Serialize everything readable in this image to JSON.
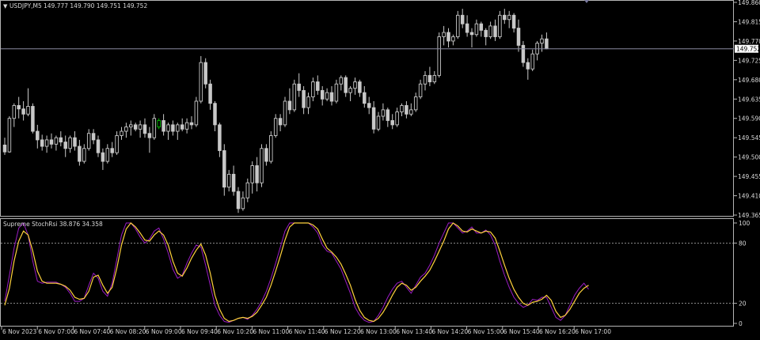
{
  "header": {
    "symbol": "USDJPY,M5",
    "ohlc": "149.777 149.790 149.751 149.752"
  },
  "indicator": {
    "label": "Supreme StochRsi 38.876 34.358"
  },
  "colors": {
    "background": "#000000",
    "candle": "#c8c8c8",
    "bull_highlight": "#00c000",
    "main_line": "#ffd23c",
    "signal_line": "#9a1cc4",
    "level_line": "#b4b4b4",
    "bid_line": "#8a8aa0",
    "frame": "#b4b4b4"
  },
  "chart_data": [
    {
      "type": "candlestick",
      "title": "USDJPY,M5",
      "ylim": [
        149.365,
        149.86
      ],
      "y_ticks": [
        "149.860",
        "149.815",
        "149.770",
        "149.725",
        "149.680",
        "149.635",
        "149.590",
        "149.545",
        "149.500",
        "149.455",
        "149.410",
        "149.365"
      ],
      "current_price": "149.752",
      "candles": [
        {
          "o": 149.528,
          "h": 149.545,
          "l": 149.505,
          "c": 149.512
        },
        {
          "o": 149.512,
          "h": 149.595,
          "l": 149.51,
          "c": 149.59
        },
        {
          "o": 149.59,
          "h": 149.625,
          "l": 149.57,
          "c": 149.62
        },
        {
          "o": 149.62,
          "h": 149.64,
          "l": 149.59,
          "c": 149.612
        },
        {
          "o": 149.612,
          "h": 149.63,
          "l": 149.585,
          "c": 149.6
        },
        {
          "o": 149.6,
          "h": 149.66,
          "l": 149.595,
          "c": 149.618
        },
        {
          "o": 149.618,
          "h": 149.625,
          "l": 149.555,
          "c": 149.56
        },
        {
          "o": 149.56,
          "h": 149.575,
          "l": 149.52,
          "c": 149.54
        },
        {
          "o": 149.54,
          "h": 149.552,
          "l": 149.515,
          "c": 149.525
        },
        {
          "o": 149.525,
          "h": 149.55,
          "l": 149.51,
          "c": 149.54
        },
        {
          "o": 149.54,
          "h": 149.555,
          "l": 149.52,
          "c": 149.53
        },
        {
          "o": 149.53,
          "h": 149.55,
          "l": 149.515,
          "c": 149.545
        },
        {
          "o": 149.545,
          "h": 149.56,
          "l": 149.525,
          "c": 149.535
        },
        {
          "o": 149.535,
          "h": 149.55,
          "l": 149.5,
          "c": 149.52
        },
        {
          "o": 149.52,
          "h": 149.55,
          "l": 149.51,
          "c": 149.545
        },
        {
          "o": 149.545,
          "h": 149.56,
          "l": 149.515,
          "c": 149.525
        },
        {
          "o": 149.525,
          "h": 149.54,
          "l": 149.48,
          "c": 149.49
        },
        {
          "o": 149.49,
          "h": 149.53,
          "l": 149.485,
          "c": 149.52
        },
        {
          "o": 149.52,
          "h": 149.565,
          "l": 149.515,
          "c": 149.555
        },
        {
          "o": 149.555,
          "h": 149.565,
          "l": 149.53,
          "c": 149.54
        },
        {
          "o": 149.54,
          "h": 149.55,
          "l": 149.5,
          "c": 149.51
        },
        {
          "o": 149.51,
          "h": 149.52,
          "l": 149.47,
          "c": 149.49
        },
        {
          "o": 149.49,
          "h": 149.53,
          "l": 149.485,
          "c": 149.52
        },
        {
          "o": 149.52,
          "h": 149.535,
          "l": 149.5,
          "c": 149.51
        },
        {
          "o": 149.51,
          "h": 149.56,
          "l": 149.505,
          "c": 149.55
        },
        {
          "o": 149.55,
          "h": 149.57,
          "l": 149.54,
          "c": 149.56
        },
        {
          "o": 149.56,
          "h": 149.58,
          "l": 149.545,
          "c": 149.57
        },
        {
          "o": 149.57,
          "h": 149.585,
          "l": 149.55,
          "c": 149.575
        },
        {
          "o": 149.575,
          "h": 149.58,
          "l": 149.56,
          "c": 149.565
        },
        {
          "o": 149.565,
          "h": 149.585,
          "l": 149.545,
          "c": 149.575
        },
        {
          "o": 149.575,
          "h": 149.59,
          "l": 149.545,
          "c": 149.555
        },
        {
          "o": 149.555,
          "h": 149.57,
          "l": 149.51,
          "c": 149.545
        },
        {
          "o": 149.545,
          "h": 149.6,
          "l": 149.54,
          "c": 149.59
        },
        {
          "o": 149.57,
          "h": 149.59,
          "l": 149.565,
          "c": 149.585
        },
        {
          "o": 149.585,
          "h": 149.6,
          "l": 149.55,
          "c": 149.56
        },
        {
          "o": 149.56,
          "h": 149.58,
          "l": 149.54,
          "c": 149.575
        },
        {
          "o": 149.575,
          "h": 149.585,
          "l": 149.55,
          "c": 149.56
        },
        {
          "o": 149.56,
          "h": 149.58,
          "l": 149.54,
          "c": 149.575
        },
        {
          "o": 149.575,
          "h": 149.59,
          "l": 149.56,
          "c": 149.565
        },
        {
          "o": 149.565,
          "h": 149.59,
          "l": 149.555,
          "c": 149.58
        },
        {
          "o": 149.58,
          "h": 149.595,
          "l": 149.565,
          "c": 149.575
        },
        {
          "o": 149.575,
          "h": 149.64,
          "l": 149.57,
          "c": 149.63
        },
        {
          "o": 149.63,
          "h": 149.735,
          "l": 149.625,
          "c": 149.72
        },
        {
          "o": 149.72,
          "h": 149.73,
          "l": 149.66,
          "c": 149.67
        },
        {
          "o": 149.67,
          "h": 149.68,
          "l": 149.61,
          "c": 149.625
        },
        {
          "o": 149.625,
          "h": 149.63,
          "l": 149.56,
          "c": 149.575
        },
        {
          "o": 149.575,
          "h": 149.58,
          "l": 149.5,
          "c": 149.515
        },
        {
          "o": 149.515,
          "h": 149.53,
          "l": 149.41,
          "c": 149.43
        },
        {
          "o": 149.43,
          "h": 149.47,
          "l": 149.42,
          "c": 149.46
        },
        {
          "o": 149.46,
          "h": 149.48,
          "l": 149.41,
          "c": 149.42
        },
        {
          "o": 149.42,
          "h": 149.43,
          "l": 149.37,
          "c": 149.38
        },
        {
          "o": 149.38,
          "h": 149.42,
          "l": 149.375,
          "c": 149.405
        },
        {
          "o": 149.405,
          "h": 149.45,
          "l": 149.395,
          "c": 149.44
        },
        {
          "o": 149.44,
          "h": 149.49,
          "l": 149.415,
          "c": 149.48
        },
        {
          "o": 149.48,
          "h": 149.5,
          "l": 149.42,
          "c": 149.44
        },
        {
          "o": 149.44,
          "h": 149.53,
          "l": 149.43,
          "c": 149.52
        },
        {
          "o": 149.52,
          "h": 149.53,
          "l": 149.48,
          "c": 149.49
        },
        {
          "o": 149.49,
          "h": 149.56,
          "l": 149.485,
          "c": 149.55
        },
        {
          "o": 149.55,
          "h": 149.6,
          "l": 149.545,
          "c": 149.59
        },
        {
          "o": 149.59,
          "h": 149.6,
          "l": 149.56,
          "c": 149.575
        },
        {
          "o": 149.575,
          "h": 149.64,
          "l": 149.57,
          "c": 149.63
        },
        {
          "o": 149.63,
          "h": 149.66,
          "l": 149.6,
          "c": 149.61
        },
        {
          "o": 149.61,
          "h": 149.68,
          "l": 149.605,
          "c": 149.67
        },
        {
          "o": 149.67,
          "h": 149.695,
          "l": 149.64,
          "c": 149.655
        },
        {
          "o": 149.655,
          "h": 149.665,
          "l": 149.6,
          "c": 149.615
        },
        {
          "o": 149.615,
          "h": 149.65,
          "l": 149.6,
          "c": 149.64
        },
        {
          "o": 149.64,
          "h": 149.685,
          "l": 149.63,
          "c": 149.675
        },
        {
          "o": 149.675,
          "h": 149.69,
          "l": 149.645,
          "c": 149.655
        },
        {
          "o": 149.655,
          "h": 149.665,
          "l": 149.62,
          "c": 149.635
        },
        {
          "o": 149.635,
          "h": 149.66,
          "l": 149.63,
          "c": 149.65
        },
        {
          "o": 149.65,
          "h": 149.665,
          "l": 149.62,
          "c": 149.63
        },
        {
          "o": 149.63,
          "h": 149.68,
          "l": 149.625,
          "c": 149.67
        },
        {
          "o": 149.67,
          "h": 149.69,
          "l": 149.655,
          "c": 149.685
        },
        {
          "o": 149.685,
          "h": 149.69,
          "l": 149.64,
          "c": 149.65
        },
        {
          "o": 149.65,
          "h": 149.665,
          "l": 149.63,
          "c": 149.66
        },
        {
          "o": 149.66,
          "h": 149.685,
          "l": 149.645,
          "c": 149.675
        },
        {
          "o": 149.675,
          "h": 149.68,
          "l": 149.64,
          "c": 149.65
        },
        {
          "o": 149.65,
          "h": 149.665,
          "l": 149.615,
          "c": 149.625
        },
        {
          "o": 149.625,
          "h": 149.64,
          "l": 149.6,
          "c": 149.615
        },
        {
          "o": 149.615,
          "h": 149.63,
          "l": 149.555,
          "c": 149.565
        },
        {
          "o": 149.565,
          "h": 149.605,
          "l": 149.56,
          "c": 149.595
        },
        {
          "o": 149.595,
          "h": 149.625,
          "l": 149.585,
          "c": 149.61
        },
        {
          "o": 149.61,
          "h": 149.615,
          "l": 149.57,
          "c": 149.585
        },
        {
          "o": 149.585,
          "h": 149.6,
          "l": 149.565,
          "c": 149.575
        },
        {
          "o": 149.575,
          "h": 149.615,
          "l": 149.57,
          "c": 149.605
        },
        {
          "o": 149.605,
          "h": 149.625,
          "l": 149.595,
          "c": 149.62
        },
        {
          "o": 149.62,
          "h": 149.63,
          "l": 149.59,
          "c": 149.6
        },
        {
          "o": 149.6,
          "h": 149.625,
          "l": 149.595,
          "c": 149.61
        },
        {
          "o": 149.61,
          "h": 149.65,
          "l": 149.605,
          "c": 149.64
        },
        {
          "o": 149.64,
          "h": 149.68,
          "l": 149.635,
          "c": 149.67
        },
        {
          "o": 149.67,
          "h": 149.7,
          "l": 149.655,
          "c": 149.69
        },
        {
          "o": 149.69,
          "h": 149.71,
          "l": 149.665,
          "c": 149.675
        },
        {
          "o": 149.675,
          "h": 149.7,
          "l": 149.67,
          "c": 149.69
        },
        {
          "o": 149.69,
          "h": 149.79,
          "l": 149.685,
          "c": 149.78
        },
        {
          "o": 149.78,
          "h": 149.805,
          "l": 149.76,
          "c": 149.79
        },
        {
          "o": 149.79,
          "h": 149.8,
          "l": 149.755,
          "c": 149.77
        },
        {
          "o": 149.77,
          "h": 149.785,
          "l": 149.76,
          "c": 149.78
        },
        {
          "o": 149.78,
          "h": 149.84,
          "l": 149.775,
          "c": 149.83
        },
        {
          "o": 149.83,
          "h": 149.845,
          "l": 149.8,
          "c": 149.81
        },
        {
          "o": 149.81,
          "h": 149.83,
          "l": 149.78,
          "c": 149.79
        },
        {
          "o": 149.79,
          "h": 149.8,
          "l": 149.755,
          "c": 149.785
        },
        {
          "o": 149.785,
          "h": 149.82,
          "l": 149.78,
          "c": 149.81
        },
        {
          "o": 149.81,
          "h": 149.815,
          "l": 149.78,
          "c": 149.795
        },
        {
          "o": 149.795,
          "h": 149.8,
          "l": 149.76,
          "c": 149.78
        },
        {
          "o": 149.78,
          "h": 149.815,
          "l": 149.775,
          "c": 149.805
        },
        {
          "o": 149.805,
          "h": 149.82,
          "l": 149.77,
          "c": 149.78
        },
        {
          "o": 149.78,
          "h": 149.84,
          "l": 149.775,
          "c": 149.83
        },
        {
          "o": 149.83,
          "h": 149.845,
          "l": 149.81,
          "c": 149.82
        },
        {
          "o": 149.82,
          "h": 149.84,
          "l": 149.8,
          "c": 149.83
        },
        {
          "o": 149.83,
          "h": 149.835,
          "l": 149.79,
          "c": 149.8
        },
        {
          "o": 149.8,
          "h": 149.82,
          "l": 149.745,
          "c": 149.76
        },
        {
          "o": 149.76,
          "h": 149.77,
          "l": 149.71,
          "c": 149.72
        },
        {
          "o": 149.72,
          "h": 149.73,
          "l": 149.68,
          "c": 149.705
        },
        {
          "o": 149.705,
          "h": 149.75,
          "l": 149.7,
          "c": 149.74
        },
        {
          "o": 149.74,
          "h": 149.77,
          "l": 149.725,
          "c": 149.765
        },
        {
          "o": 149.765,
          "h": 149.785,
          "l": 149.745,
          "c": 149.775
        },
        {
          "o": 149.775,
          "h": 149.79,
          "l": 149.751,
          "c": 149.752
        }
      ]
    },
    {
      "type": "line",
      "title": "Supreme StochRsi",
      "ylim": [
        0,
        100
      ],
      "y_ticks": [
        "100",
        "80",
        "20",
        "0"
      ],
      "levels": [
        80,
        20
      ],
      "x_tick_labels": [
        "6 Nov 2023",
        "6 Nov 07:00",
        "6 Nov 07:40",
        "6 Nov 08:20",
        "6 Nov 09:00",
        "6 Nov 09:40",
        "6 Nov 10:20",
        "6 Nov 11:00",
        "6 Nov 11:40",
        "6 Nov 12:20",
        "6 Nov 13:00",
        "6 Nov 13:40",
        "6 Nov 14:20",
        "6 Nov 15:00",
        "6 Nov 15:40",
        "6 Nov 16:20",
        "6 Nov 17:00"
      ],
      "series": [
        {
          "values": [
            18,
            35,
            62,
            82,
            92,
            88,
            72,
            52,
            42,
            40,
            40,
            40,
            39,
            37,
            33,
            26,
            24,
            25,
            32,
            46,
            48,
            38,
            30,
            36,
            55,
            78,
            94,
            100,
            96,
            90,
            83,
            82,
            88,
            92,
            88,
            78,
            62,
            50,
            47,
            55,
            65,
            73,
            79,
            68,
            50,
            28,
            14,
            5,
            2,
            3,
            5,
            6,
            5,
            7,
            11,
            18,
            26,
            38,
            52,
            67,
            83,
            96,
            100,
            100,
            100,
            100,
            98,
            94,
            84,
            75,
            71,
            66,
            59,
            49,
            38,
            24,
            13,
            6,
            3,
            2,
            5,
            11,
            19,
            28,
            36,
            40,
            38,
            33,
            36,
            42,
            47,
            53,
            62,
            72,
            82,
            94,
            100,
            97,
            92,
            91,
            94,
            92,
            90,
            92,
            91,
            85,
            72,
            58,
            45,
            34,
            26,
            20,
            18,
            21,
            22,
            24,
            28,
            23,
            12,
            6,
            8,
            14,
            22,
            30,
            35,
            38
          ]
        },
        {
          "values": [
            22,
            48,
            75,
            95,
            100,
            88,
            62,
            42,
            40,
            41,
            41,
            41,
            39,
            36,
            30,
            22,
            22,
            25,
            38,
            50,
            45,
            32,
            27,
            40,
            64,
            88,
            100,
            100,
            94,
            86,
            80,
            84,
            92,
            95,
            84,
            70,
            54,
            45,
            48,
            60,
            70,
            78,
            76,
            58,
            38,
            18,
            8,
            2,
            1,
            3,
            5,
            6,
            4,
            8,
            14,
            22,
            32,
            45,
            60,
            76,
            92,
            100,
            100,
            100,
            100,
            100,
            96,
            90,
            78,
            72,
            70,
            62,
            54,
            42,
            30,
            16,
            8,
            3,
            1,
            2,
            8,
            16,
            26,
            34,
            40,
            42,
            36,
            30,
            38,
            46,
            50,
            58,
            68,
            80,
            90,
            100,
            100,
            95,
            90,
            92,
            96,
            90,
            90,
            93,
            88,
            78,
            62,
            48,
            36,
            26,
            20,
            16,
            18,
            24,
            23,
            26,
            26,
            16,
            6,
            3,
            8,
            18,
            28,
            35,
            40,
            34
          ]
        }
      ]
    }
  ]
}
